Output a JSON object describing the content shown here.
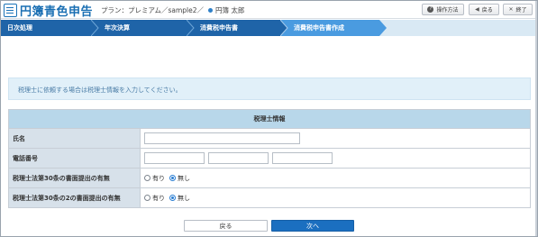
{
  "app": {
    "title": "円簿青色申告",
    "plan_label": "プラン：プレミアム／sample2／",
    "user_name": "円簿 太郎"
  },
  "header_buttons": {
    "help": "操作方法",
    "back": "戻る",
    "close": "終了"
  },
  "steps": [
    {
      "label": "日次処理",
      "active": false
    },
    {
      "label": "年次決算",
      "active": false
    },
    {
      "label": "消費税申告書",
      "active": false
    },
    {
      "label": "消費税申告書作成",
      "active": true
    }
  ],
  "notice": "税理士に依頼する場合は税理士情報を入力してください。",
  "form": {
    "title": "税理士情報",
    "name_label": "氏名",
    "name_value": "",
    "phone_label": "電話番号",
    "phone_values": [
      "",
      "",
      ""
    ],
    "art30_label": "税理士法第30条の書面提出の有無",
    "art33_label": "税理士法第30条の2の書面提出の有無",
    "radio_yes": "有り",
    "radio_no": "無し",
    "art30_selected": "無し",
    "art33_selected": "無し"
  },
  "buttons": {
    "back": "戻る",
    "next": "次へ"
  },
  "colors": {
    "brand": "#1a6fb3",
    "step_dark": "#1f64a8",
    "step_active": "#4a9be0",
    "primary_button": "#1b6fc0"
  }
}
